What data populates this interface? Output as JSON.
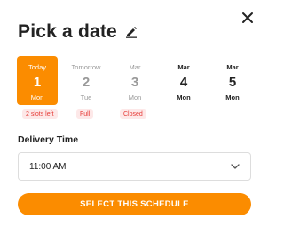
{
  "dialog": {
    "title": "Pick a date",
    "close_icon": "close-icon",
    "edit_icon": "pencil-icon"
  },
  "days": [
    {
      "top": "Today",
      "num": "1",
      "bottom": "Mon",
      "state": "selected",
      "badge": "2 slots left"
    },
    {
      "top": "Tomorrow",
      "num": "2",
      "bottom": "Tue",
      "state": "disabled",
      "badge": "Full"
    },
    {
      "top": "Mar",
      "num": "3",
      "bottom": "Mon",
      "state": "disabled",
      "badge": "Closed"
    },
    {
      "top": "Mar",
      "num": "4",
      "bottom": "Mon",
      "state": "active",
      "badge": ""
    },
    {
      "top": "Mar",
      "num": "5",
      "bottom": "Mon",
      "state": "active",
      "badge": ""
    }
  ],
  "delivery": {
    "label": "Delivery Time",
    "selected_value": "11:00 AM",
    "chevron_icon": "chevron-down-icon"
  },
  "cta": {
    "label": "SELECT THIS SCHEDULE"
  },
  "colors": {
    "accent": "#fb8c00",
    "badge_bg": "#fde8e8",
    "badge_text": "#e53935"
  }
}
